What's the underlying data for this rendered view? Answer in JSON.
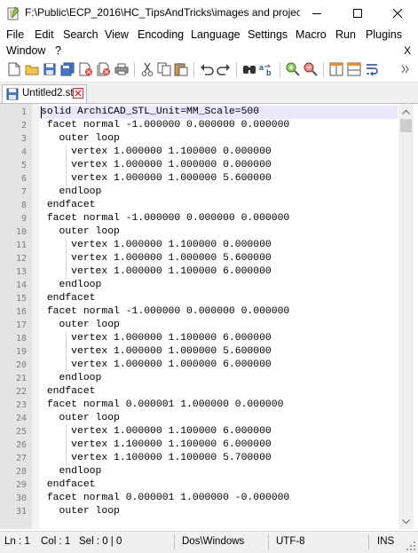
{
  "window": {
    "title": "F:\\Public\\ECP_2016\\HC_TipsAndTricks\\images and projects t..."
  },
  "menu": [
    {
      "label": "File",
      "name": "menu-file"
    },
    {
      "label": "Edit",
      "name": "menu-edit"
    },
    {
      "label": "Search",
      "name": "menu-search"
    },
    {
      "label": "View",
      "name": "menu-view"
    },
    {
      "label": "Encoding",
      "name": "menu-encoding"
    },
    {
      "label": "Language",
      "name": "menu-language"
    },
    {
      "label": "Settings",
      "name": "menu-settings"
    },
    {
      "label": "Macro",
      "name": "menu-macro"
    },
    {
      "label": "Run",
      "name": "menu-run"
    },
    {
      "label": "Plugins",
      "name": "menu-plugins"
    },
    {
      "label": "Window",
      "name": "menu-window"
    },
    {
      "label": "?",
      "name": "menu-help"
    }
  ],
  "menu_close": "X",
  "toolbar": [
    "new-file-icon",
    "open-file-icon",
    "save-icon",
    "save-all-icon",
    "close-icon",
    "close-all-icon",
    "print-icon",
    "cut-icon",
    "copy-icon",
    "paste-icon",
    "undo-icon",
    "redo-icon",
    "find-icon",
    "replace-icon",
    "zoom-in-icon",
    "zoom-out-icon",
    "sync-vertical-icon",
    "sync-horizontal-icon",
    "word-wrap-icon"
  ],
  "tab": {
    "label": "Untitled2.stl",
    "accent": "#d03030"
  },
  "editor": {
    "lines": [
      {
        "n": "1",
        "text": "solid ArchiCAD_STL_Unit=MM_Scale=500"
      },
      {
        "n": "2",
        "text": " facet normal -1.000000 0.000000 0.000000"
      },
      {
        "n": "3",
        "text": "   outer loop"
      },
      {
        "n": "4",
        "text": "     vertex 1.000000 1.100000 0.000000"
      },
      {
        "n": "5",
        "text": "     vertex 1.000000 1.000000 0.000000"
      },
      {
        "n": "6",
        "text": "     vertex 1.000000 1.000000 5.600000"
      },
      {
        "n": "7",
        "text": "   endloop"
      },
      {
        "n": "8",
        "text": " endfacet"
      },
      {
        "n": "9",
        "text": " facet normal -1.000000 0.000000 0.000000"
      },
      {
        "n": "10",
        "text": "   outer loop"
      },
      {
        "n": "11",
        "text": "     vertex 1.000000 1.100000 0.000000"
      },
      {
        "n": "12",
        "text": "     vertex 1.000000 1.000000 5.600000"
      },
      {
        "n": "13",
        "text": "     vertex 1.000000 1.100000 6.000000"
      },
      {
        "n": "14",
        "text": "   endloop"
      },
      {
        "n": "15",
        "text": " endfacet"
      },
      {
        "n": "16",
        "text": " facet normal -1.000000 0.000000 0.000000"
      },
      {
        "n": "17",
        "text": "   outer loop"
      },
      {
        "n": "18",
        "text": "     vertex 1.000000 1.100000 6.000000"
      },
      {
        "n": "19",
        "text": "     vertex 1.000000 1.000000 5.600000"
      },
      {
        "n": "20",
        "text": "     vertex 1.000000 1.000000 6.000000"
      },
      {
        "n": "21",
        "text": "   endloop"
      },
      {
        "n": "22",
        "text": " endfacet"
      },
      {
        "n": "23",
        "text": " facet normal 0.000001 1.000000 0.000000"
      },
      {
        "n": "24",
        "text": "   outer loop"
      },
      {
        "n": "25",
        "text": "     vertex 1.000000 1.100000 6.000000"
      },
      {
        "n": "26",
        "text": "     vertex 1.100000 1.100000 6.000000"
      },
      {
        "n": "27",
        "text": "     vertex 1.100000 1.100000 5.700000"
      },
      {
        "n": "28",
        "text": "   endloop"
      },
      {
        "n": "29",
        "text": " endfacet"
      },
      {
        "n": "30",
        "text": " facet normal 0.000001 1.000000 -0.000000"
      },
      {
        "n": "31",
        "text": "   outer loop"
      }
    ]
  },
  "status": {
    "ln": "Ln : 1",
    "col": "Col : 1",
    "sel": "Sel : 0 | 0",
    "eol": "Dos\\Windows",
    "encoding": "UTF-8",
    "mode": "INS"
  },
  "colors": {
    "current_line": "#e8e8ff",
    "gutter": "#e4e4e4"
  }
}
